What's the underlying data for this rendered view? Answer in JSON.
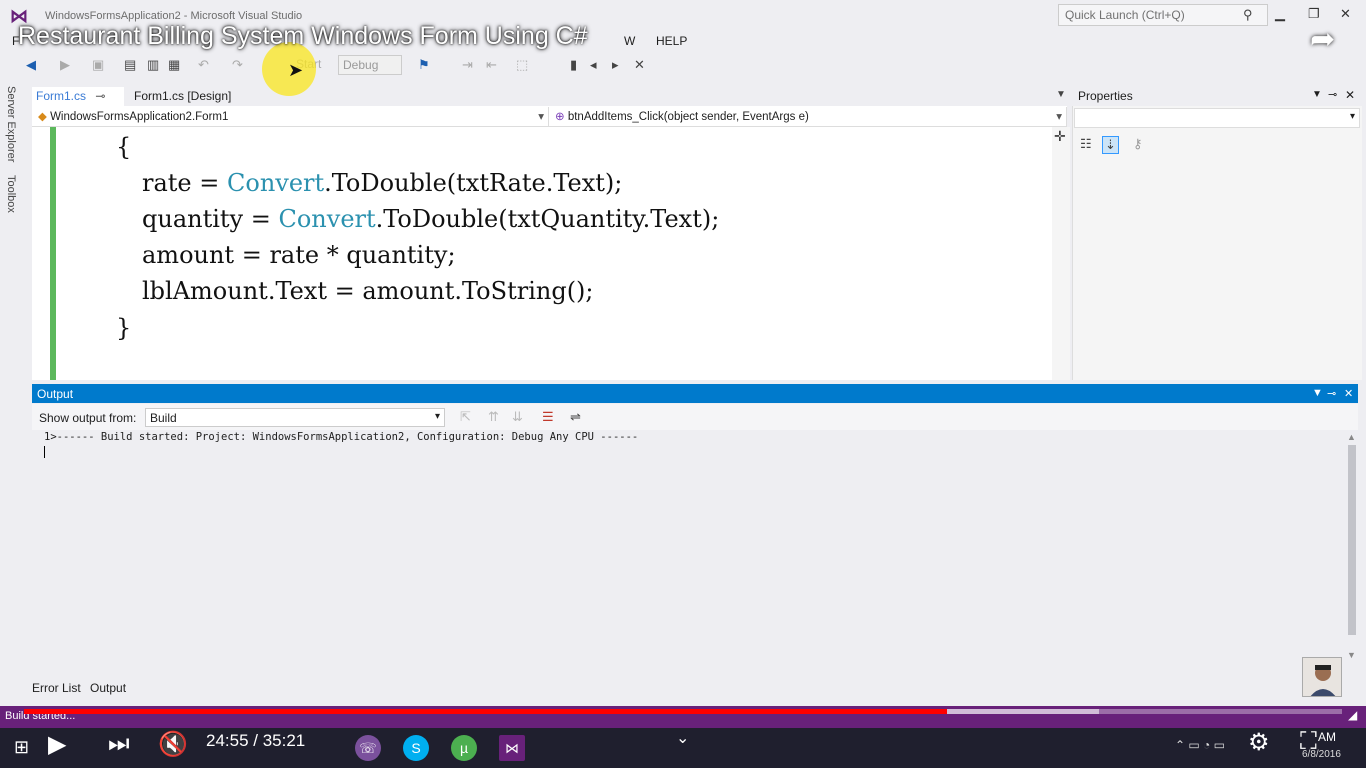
{
  "window": {
    "title": "WindowsFormsApplication2 - Microsoft Visual Studio",
    "quick_launch_placeholder": "Quick Launch (Ctrl+Q)"
  },
  "video": {
    "title": "Restaurant Billing System Windows Form Using C#",
    "time": "24:55 / 35:21",
    "progress_played_fraction": 0.7,
    "progress_buffered_fraction": 0.816
  },
  "menu": {
    "items": [
      "F",
      "W",
      "HELP"
    ]
  },
  "toolbar": {
    "start_label": "Start",
    "config_label": "Debug"
  },
  "side_tabs": [
    "Server Explorer",
    "Toolbox"
  ],
  "doc_tabs": [
    {
      "label": "Form1.cs"
    },
    {
      "label": "Form1.cs [Design]"
    }
  ],
  "nav": {
    "class_selector": "WindowsFormsApplication2.Form1",
    "member_selector": "btnAddItems_Click(object sender, EventArgs e)"
  },
  "code": {
    "open_brace": "{",
    "line1": {
      "a": "rate = ",
      "type": "Convert",
      "b": ".ToDouble(txtRate.Text);"
    },
    "line2": {
      "a": "quantity = ",
      "type": "Convert",
      "b": ".ToDouble(txtQuantity.Text);"
    },
    "line3": "amount = rate * quantity;",
    "line4": "lblAmount.Text = amount.ToString();",
    "close_brace": "}"
  },
  "properties": {
    "title": "Properties"
  },
  "output": {
    "title": "Output",
    "show_from_label": "Show output from:",
    "show_from_value": "Build",
    "text": "1>------ Build started: Project: WindowsFormsApplication2, Configuration: Debug Any CPU ------"
  },
  "bottom_tabs": [
    "Error List",
    "Output"
  ],
  "status": {
    "text": "Build started..."
  },
  "clock": {
    "time": "AM",
    "date": "6/8/2016"
  },
  "colors": {
    "accent": "#007acc",
    "statusbar": "#68217a",
    "type_color": "#2b91af",
    "progress": "#ff0000"
  }
}
